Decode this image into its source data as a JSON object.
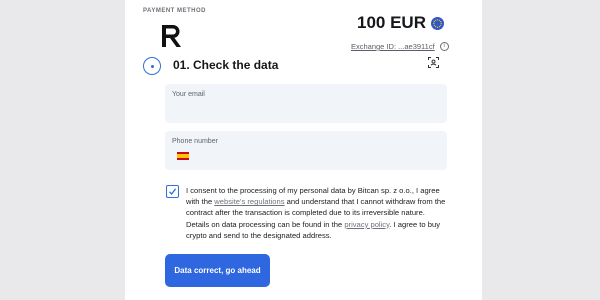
{
  "payment_method_label": "PAYMENT METHOD",
  "logo_icon": "revolut-logo-icon",
  "amount": "100 EUR",
  "currency_icon": "eu-stars-icon",
  "exchange_id": "Exchange ID: ...ae3911cf",
  "info_icon": "info-icon",
  "step": {
    "title": "01. Check the data",
    "scan_icon": "scan-icon"
  },
  "email": {
    "label": "Your email",
    "value": ""
  },
  "phone": {
    "label": "Phone number",
    "value": "",
    "flag_icon": "spain-flag-icon"
  },
  "consent": {
    "checked": true,
    "part1": "I consent to the processing of my personal data by Bitcan sp. z o.o., I agree with the ",
    "link1": "website's regulations",
    "part2": " and understand that I cannot withdraw from the contract after the transaction is completed due to its irreversible nature. Details on data processing can be found in the ",
    "link2": "privacy policy",
    "part3": ". I agree to buy crypto and send to the designated address."
  },
  "submit_label": "Data correct, go ahead",
  "colors": {
    "accent": "#2f67e0",
    "field_bg": "#f1f4f9",
    "page_bg": "#e9e9eb"
  }
}
